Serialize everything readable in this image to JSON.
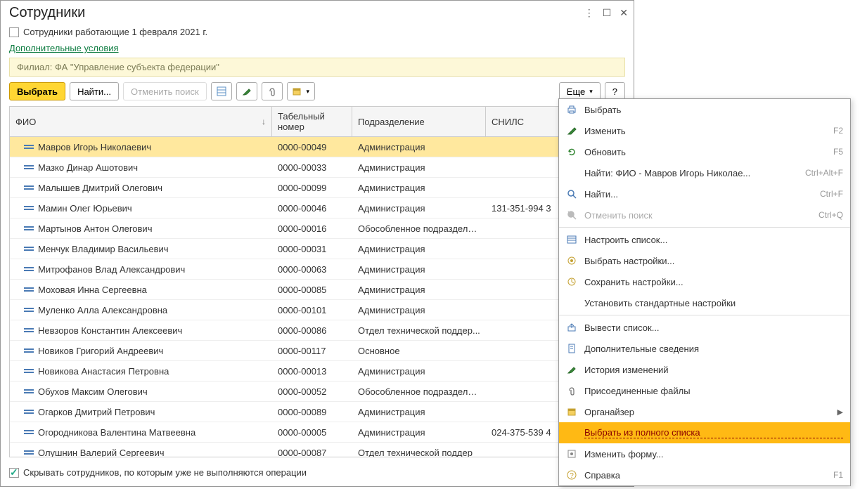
{
  "title": "Сотрудники",
  "filter_checkbox_label": "Сотрудники работающие 1 февраля 2021 г.",
  "extra_conditions_link": "Дополнительные условия",
  "filter_bar_text": "Филиал: ФА \"Управление субъекта федерации\"",
  "toolbar": {
    "select": "Выбрать",
    "find": "Найти...",
    "cancel_search": "Отменить поиск",
    "more": "Еще",
    "help": "?"
  },
  "columns": {
    "fio": "ФИО",
    "tab": "Табельный номер",
    "dept": "Подразделение",
    "snils": "СНИЛС"
  },
  "rows": [
    {
      "fio": "Мавров Игорь Николаевич",
      "tab": "0000-00049",
      "dept": "Администрация",
      "snils": "",
      "sel": true
    },
    {
      "fio": "Мазко Динар Ашотович",
      "tab": "0000-00033",
      "dept": "Администрация",
      "snils": ""
    },
    {
      "fio": "Малышев Дмитрий Олегович",
      "tab": "0000-00099",
      "dept": "Администрация",
      "snils": ""
    },
    {
      "fio": "Мамин Олег Юрьевич",
      "tab": "0000-00046",
      "dept": "Администрация",
      "snils": "131-351-994 3"
    },
    {
      "fio": "Мартынов Антон Олегович",
      "tab": "0000-00016",
      "dept": "Обособленное подразделе...",
      "snils": ""
    },
    {
      "fio": "Менчук Владимир Васильевич",
      "tab": "0000-00031",
      "dept": "Администрация",
      "snils": ""
    },
    {
      "fio": "Митрофанов Влад Александрович",
      "tab": "0000-00063",
      "dept": "Администрация",
      "snils": ""
    },
    {
      "fio": "Моховая Инна Сергеевна",
      "tab": "0000-00085",
      "dept": "Администрация",
      "snils": ""
    },
    {
      "fio": "Муленко Алла Александровна",
      "tab": "0000-00101",
      "dept": "Администрация",
      "snils": ""
    },
    {
      "fio": "Невзоров Константин Алексеевич",
      "tab": "0000-00086",
      "dept": "Отдел технической поддер...",
      "snils": ""
    },
    {
      "fio": "Новиков Григорий Андреевич",
      "tab": "0000-00117",
      "dept": "Основное",
      "snils": ""
    },
    {
      "fio": "Новикова Анастасия Петровна",
      "tab": "0000-00013",
      "dept": "Администрация",
      "snils": ""
    },
    {
      "fio": "Обухов Максим Олегович",
      "tab": "0000-00052",
      "dept": "Обособленное подразделе...",
      "snils": ""
    },
    {
      "fio": "Огарков Дмитрий Петрович",
      "tab": "0000-00089",
      "dept": "Администрация",
      "snils": ""
    },
    {
      "fio": "Огородникова Валентина Матвеевна",
      "tab": "0000-00005",
      "dept": "Администрация",
      "snils": "024-375-539 4"
    },
    {
      "fio": "Олушнин Валерий Сергеевич",
      "tab": "0000-00087",
      "dept": "Отдел технической поддер",
      "snils": ""
    }
  ],
  "footer_checkbox_label": "Скрывать сотрудников, по которым уже не выполняются операции",
  "menu": [
    {
      "icon": "print",
      "label": "Выбрать"
    },
    {
      "icon": "edit",
      "label": "Изменить",
      "shortcut": "F2"
    },
    {
      "icon": "refresh",
      "label": "Обновить",
      "shortcut": "F5"
    },
    {
      "icon": "",
      "label": "Найти: ФИО - Мавров Игорь Николае...",
      "shortcut": "Ctrl+Alt+F"
    },
    {
      "icon": "search",
      "label": "Найти...",
      "shortcut": "Ctrl+F"
    },
    {
      "icon": "cancel-search",
      "label": "Отменить поиск",
      "shortcut": "Ctrl+Q",
      "disabled": true
    },
    {
      "sep": true
    },
    {
      "icon": "list-settings",
      "label": "Настроить список..."
    },
    {
      "icon": "pick-settings",
      "label": "Выбрать настройки..."
    },
    {
      "icon": "save-settings",
      "label": "Сохранить настройки..."
    },
    {
      "icon": "",
      "label": "Установить стандартные настройки"
    },
    {
      "sep": true
    },
    {
      "icon": "export",
      "label": "Вывести список..."
    },
    {
      "icon": "doc",
      "label": "Дополнительные сведения"
    },
    {
      "icon": "history",
      "label": "История изменений"
    },
    {
      "icon": "attach",
      "label": "Присоединенные файлы"
    },
    {
      "icon": "organizer",
      "label": "Органайзер",
      "arrow": true
    },
    {
      "icon": "",
      "label": "Выбрать из полного списка",
      "highlight": true
    },
    {
      "icon": "form",
      "label": "Изменить форму..."
    },
    {
      "icon": "help",
      "label": "Справка",
      "shortcut": "F1"
    }
  ]
}
